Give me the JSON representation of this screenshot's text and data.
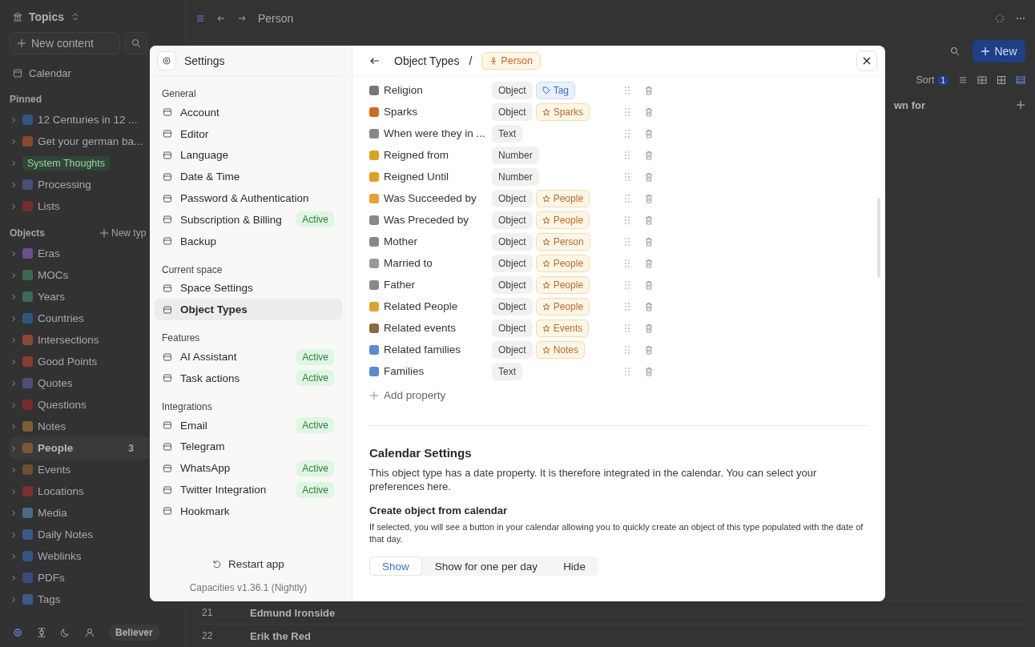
{
  "sidebar": {
    "space": "Topics",
    "new_content": "New content",
    "calendar": "Calendar",
    "pinned": {
      "title": "Pinned",
      "items": [
        {
          "label": "12 Centuries in 12 ...",
          "tagged": false
        },
        {
          "label": "Get your german ba...",
          "tagged": false
        },
        {
          "label": "System Thoughts",
          "tagged": true
        },
        {
          "label": "Processing",
          "tagged": false
        },
        {
          "label": "Lists",
          "tagged": false
        }
      ]
    },
    "objects": {
      "title": "Objects",
      "new_type": "New typ",
      "items": [
        {
          "label": "Eras",
          "selected": false
        },
        {
          "label": "MOCs",
          "selected": false
        },
        {
          "label": "Years",
          "selected": false
        },
        {
          "label": "Countries",
          "selected": false
        },
        {
          "label": "Intersections",
          "selected": false
        },
        {
          "label": "Good Points",
          "selected": false
        },
        {
          "label": "Quotes",
          "selected": false
        },
        {
          "label": "Questions",
          "selected": false
        },
        {
          "label": "Notes",
          "selected": false
        },
        {
          "label": "People",
          "selected": true,
          "count": "3"
        },
        {
          "label": "Events",
          "selected": false
        },
        {
          "label": "Locations",
          "selected": false
        },
        {
          "label": "Media",
          "selected": false
        },
        {
          "label": "Daily Notes",
          "selected": false
        },
        {
          "label": "Weblinks",
          "selected": false
        },
        {
          "label": "PDFs",
          "selected": false
        },
        {
          "label": "Tags",
          "selected": false
        }
      ]
    },
    "plan": "Believer"
  },
  "topbar": {
    "breadcrumb": "Person"
  },
  "toolbar": {
    "new_button": "New",
    "sort": "Sort",
    "sort_count": "1"
  },
  "table": {
    "column_header": "wn for",
    "rows": [
      {
        "number": "21",
        "name": "Edmund Ironside"
      },
      {
        "number": "22",
        "name": "Erik the Red"
      }
    ]
  },
  "settings": {
    "title": "Settings",
    "sections": [
      {
        "title": "General",
        "items": [
          {
            "label": "Account",
            "selected": false
          },
          {
            "label": "Editor",
            "selected": false
          },
          {
            "label": "Language",
            "selected": false
          },
          {
            "label": "Date & Time",
            "selected": false
          },
          {
            "label": "Password & Authentication",
            "selected": false
          },
          {
            "label": "Subscription & Billing",
            "selected": false,
            "badge": "Active"
          },
          {
            "label": "Backup",
            "selected": false
          }
        ]
      },
      {
        "title": "Current space",
        "items": [
          {
            "label": "Space Settings",
            "selected": false
          },
          {
            "label": "Object Types",
            "selected": true
          }
        ]
      },
      {
        "title": "Features",
        "items": [
          {
            "label": "AI Assistant",
            "selected": false,
            "badge": "Active"
          },
          {
            "label": "Task actions",
            "selected": false,
            "badge": "Active"
          }
        ]
      },
      {
        "title": "Integrations",
        "items": [
          {
            "label": "Email",
            "selected": false,
            "badge": "Active"
          },
          {
            "label": "Telegram",
            "selected": false
          },
          {
            "label": "WhatsApp",
            "selected": false,
            "badge": "Active"
          },
          {
            "label": "Twitter Integration",
            "selected": false,
            "badge": "Active"
          },
          {
            "label": "Hookmark",
            "selected": false
          }
        ]
      }
    ],
    "restart": "Restart app",
    "version": "Capacities v1.36.1 (Nightly)"
  },
  "object_types": {
    "title": "Object Types",
    "separator": "/",
    "type_tag": "Person",
    "properties": [
      {
        "name": "Religion",
        "type": "Object",
        "target": {
          "label": "Tag",
          "kind": "tag"
        }
      },
      {
        "name": "Sparks",
        "type": "Object",
        "target": {
          "label": "Sparks",
          "kind": "object"
        }
      },
      {
        "name": "When were they in ...",
        "type": "Text"
      },
      {
        "name": "Reigned from",
        "type": "Number"
      },
      {
        "name": "Reigned Until",
        "type": "Number"
      },
      {
        "name": "Was Succeeded by",
        "type": "Object",
        "target": {
          "label": "People",
          "kind": "object"
        }
      },
      {
        "name": "Was Preceded by",
        "type": "Object",
        "target": {
          "label": "People",
          "kind": "object"
        }
      },
      {
        "name": "Mother",
        "type": "Object",
        "target": {
          "label": "Person",
          "kind": "object"
        }
      },
      {
        "name": "Married to",
        "type": "Object",
        "target": {
          "label": "People",
          "kind": "object"
        }
      },
      {
        "name": "Father",
        "type": "Object",
        "target": {
          "label": "People",
          "kind": "object"
        }
      },
      {
        "name": "Related People",
        "type": "Object",
        "target": {
          "label": "People",
          "kind": "object"
        }
      },
      {
        "name": "Related events",
        "type": "Object",
        "target": {
          "label": "Events",
          "kind": "object"
        }
      },
      {
        "name": "Related families",
        "type": "Object",
        "target": {
          "label": "Notes",
          "kind": "object"
        }
      },
      {
        "name": "Families",
        "type": "Text"
      }
    ],
    "add_property": "Add property",
    "calendar": {
      "title": "Calendar Settings",
      "description": "This object type has a date property. It is therefore integrated in the calendar. You can select your preferences here.",
      "option_title": "Create object from calendar",
      "option_description": "If selected, you will see a button in your calendar allowing you to quickly create an object of this type populated with the date of that day.",
      "choices": [
        {
          "label": "Show",
          "selected": true
        },
        {
          "label": "Show for one per day",
          "selected": false
        },
        {
          "label": "Hide",
          "selected": false
        }
      ]
    }
  }
}
